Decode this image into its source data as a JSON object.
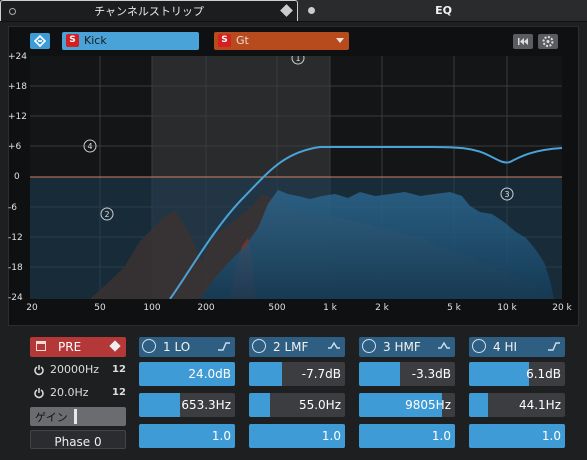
{
  "tabs": {
    "channel_strip": "チャンネルストリップ",
    "eq": "EQ"
  },
  "toolbar": {
    "kick_label": "Kick",
    "gt_label": "Gt",
    "s_badge": "S"
  },
  "graph": {
    "y_labels": [
      "+24",
      "+18",
      "+12",
      "+6",
      "0",
      "-6",
      "-12",
      "-18",
      "-24"
    ],
    "x_labels": [
      "20",
      "50",
      "100",
      "200",
      "500",
      "1 k",
      "2 k",
      "5 k",
      "10 k",
      "20 k"
    ],
    "band_markers": [
      "1",
      "2",
      "3",
      "4"
    ]
  },
  "pre": {
    "label": "PRE",
    "lowcut": "20000Hz",
    "highcut": "20.0Hz",
    "gain_label": "ゲイン",
    "phase_label": "Phase 0"
  },
  "bands": [
    {
      "label": "1 LO",
      "gain": "24.0dB",
      "freq": "653.3Hz",
      "q": "1.0",
      "gain_fill": 1.0,
      "freq_fill": 0.43
    },
    {
      "label": "2 LMF",
      "gain": "-7.7dB",
      "freq": "55.0Hz",
      "q": "1.0",
      "gain_fill": 0.34,
      "freq_fill": 0.22
    },
    {
      "label": "3 HMF",
      "gain": "-3.3dB",
      "freq": "9805Hz",
      "q": "1.0",
      "gain_fill": 0.43,
      "freq_fill": 0.86
    },
    {
      "label": "4 HI",
      "gain": "6.1dB",
      "freq": "44.1Hz",
      "q": "1.0",
      "gain_fill": 0.63,
      "freq_fill": 0.2
    }
  ],
  "colors": {
    "accent": "#3f9bd6",
    "kick": "#49a3d8",
    "gt": "#b84b1e",
    "pre": "#b43838"
  }
}
